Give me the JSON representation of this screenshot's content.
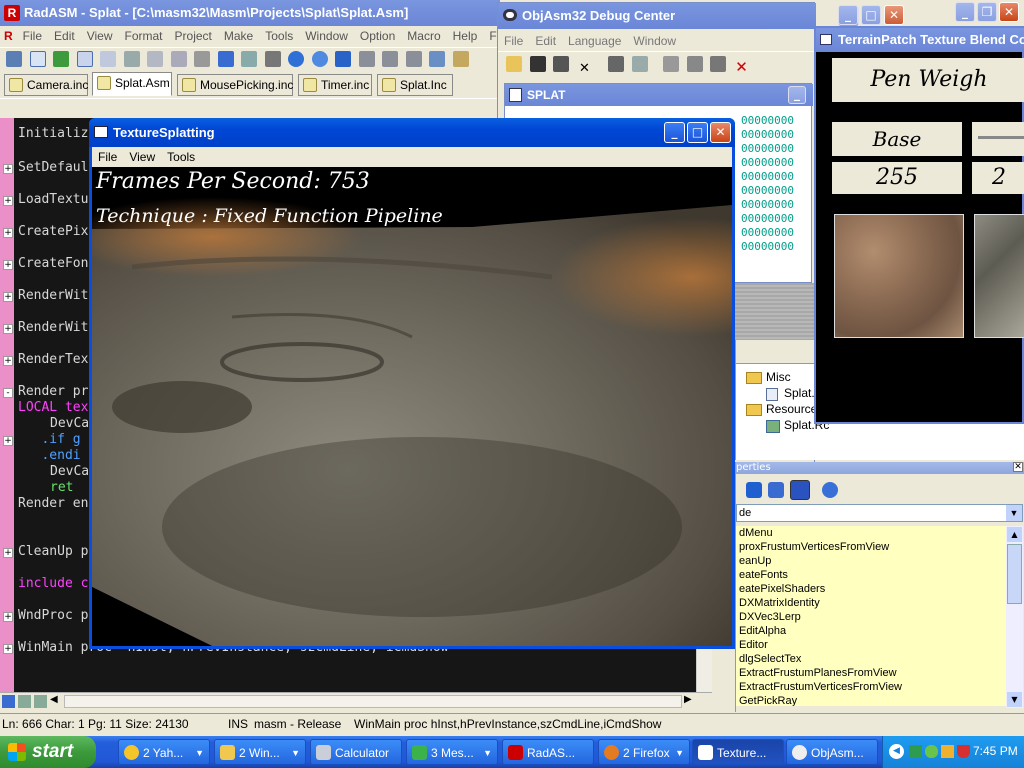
{
  "radasm": {
    "title": "RadASM - Splat - [C:\\masm32\\Masm\\Projects\\Splat\\Splat.Asm]",
    "menu": [
      "File",
      "Edit",
      "View",
      "Format",
      "Project",
      "Make",
      "Tools",
      "Window",
      "Option",
      "Macro",
      "Help",
      "Favourite"
    ],
    "tabs": [
      "Camera.inc",
      "Splat.Asm",
      "MousePicking.inc",
      "Timer.inc",
      "Splat.Inc"
    ],
    "code_lines": [
      "Initializ",
      "SetDefaul",
      "LoadTextu",
      "CreatePix",
      "CreateFon",
      "RenderWit",
      "RenderWit",
      "RenderTex",
      "Render pr",
      "LOCAL tex",
      "DevCa",
      "   .if g",
      "   .endi",
      "DevCa",
      "ret",
      "Render en",
      "CleanUp p",
      "include c",
      "WndProc p",
      "WinMain proc  hInst, hPrevInstance, szCmdLine, iCmdShow"
    ],
    "status": {
      "position": "Ln: 666 Char: 1 Pg: 11 Size: 24130",
      "mode": "INS",
      "build": "masm - Release",
      "proc": "WinMain proc hInst,hPrevInstance,szCmdLine,iCmdShow"
    }
  },
  "objasm": {
    "title": "ObjAsm32 Debug Center",
    "menu": [
      "File",
      "Edit",
      "Language",
      "Window"
    ],
    "child_title": "SPLAT",
    "hex_values": [
      "00000000",
      "00000000",
      "00000000",
      "00000000",
      "00000000",
      "00000000",
      "00000000",
      "00000000",
      "00000000",
      "00000000"
    ]
  },
  "terrain": {
    "title": "TerrainPatch Texture Blend Co",
    "pen_label": "Pen Weigh",
    "base_label": "Base Texture",
    "base_value": "255",
    "second_value": "2"
  },
  "project_tree": {
    "misc": "Misc",
    "misc_file": "Splat.T",
    "resource": "Resource",
    "resource_file": "Splat.Rc"
  },
  "properties": {
    "title": "perties",
    "dropdown": "de",
    "items": [
      "dMenu",
      "proxFrustumVerticesFromView",
      "eanUp",
      "eateFonts",
      "eatePixelShaders",
      "DXMatrixIdentity",
      "DXVec3Lerp",
      "EditAlpha",
      "Editor",
      "dlgSelectTex",
      "ExtractFrustumPlanesFromView",
      "ExtractFrustumVerticesFromView",
      "GetPickRay"
    ]
  },
  "texsplat": {
    "title": "TextureSplatting",
    "menu": [
      "File",
      "View",
      "Tools"
    ],
    "fps": "Frames Per Second: 753",
    "technique": "Technique : Fixed Function Pipeline"
  },
  "taskbar": {
    "start": "start",
    "items": [
      "2 Yah...",
      "2 Win...",
      "Calculator",
      "3 Mes...",
      "RadAS...",
      "2 Firefox",
      "Texture...",
      "ObjAsm..."
    ],
    "clock": "7:45 PM"
  }
}
